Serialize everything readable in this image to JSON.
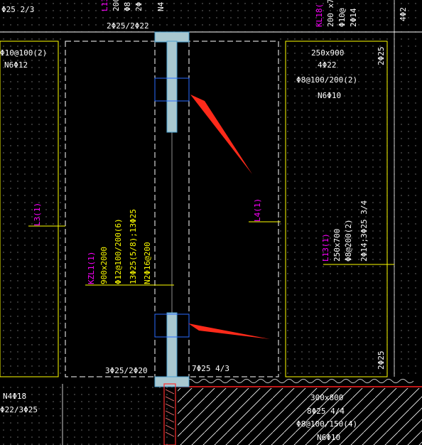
{
  "colors": {
    "background": "#000000",
    "dashed_outline": "#ffffff",
    "column_fill": "#a8c8d0",
    "column_outline": "#4aa0d0",
    "grid_dot": "#7f7f7f",
    "annotation_white": "#ffffff",
    "annotation_magenta": "#ff00ff",
    "annotation_yellow": "#ffff00",
    "arrow": "#ff2a1a",
    "ground_hatch": "#ffffff",
    "ground_border": "#ff2020"
  },
  "labels": {
    "top_left_partial": "Φ25 2/3",
    "top_col_a_1": "L13",
    "top_col_a_2": "200",
    "top_col_a_3": "Φ8",
    "top_col_a_4": "2Φ",
    "top_col_b": "N4",
    "top_beam_rebar": "2Φ25/2Φ22",
    "left_stirrup": "Φ10@100(2)",
    "left_side_bar": "N6Φ12",
    "left_beam_id": "L3(1)",
    "kl_top_right_1": "KL18(",
    "kl_top_right_2": "200 x7",
    "kl_top_right_3": "Φ10@",
    "kl_top_right_4": "2Φ14",
    "right_top_4": "4Φ2",
    "right_beam_size": "250x900",
    "right_beam_top": "4Φ22",
    "right_beam_stirrup": "Φ8@100/200(2)",
    "right_beam_side": "N6Φ10",
    "right_vert_top": "2Φ25",
    "l4_label": "L4(1)",
    "l13_1": "L13(1)",
    "l13_2": "250x700",
    "l13_3": "Φ8@200(2)",
    "l13_4": "2Φ14;3Φ25 3/4",
    "right_vert_bottom": "2Φ25",
    "kzl_1": "KZL1(1)",
    "kzl_2": "900x2000",
    "kzl_3": "Φ12@100/200(6)",
    "kzl_4": "13Φ25(5/8);13Φ25",
    "kzl_5": "N2Φ16@200",
    "bottom_left_rebar": "3Φ25/2Φ20",
    "bottom_mid_rebar": "7Φ25 4/3",
    "bottom_left_1": "N4Φ18",
    "bottom_left_2": "Φ22/3Φ25",
    "bottom_right_1": "300x800",
    "bottom_right_2": "8Φ25 4/4",
    "bottom_right_3": "Φ8@100/150(4)",
    "bottom_right_4": "N6Φ10"
  }
}
